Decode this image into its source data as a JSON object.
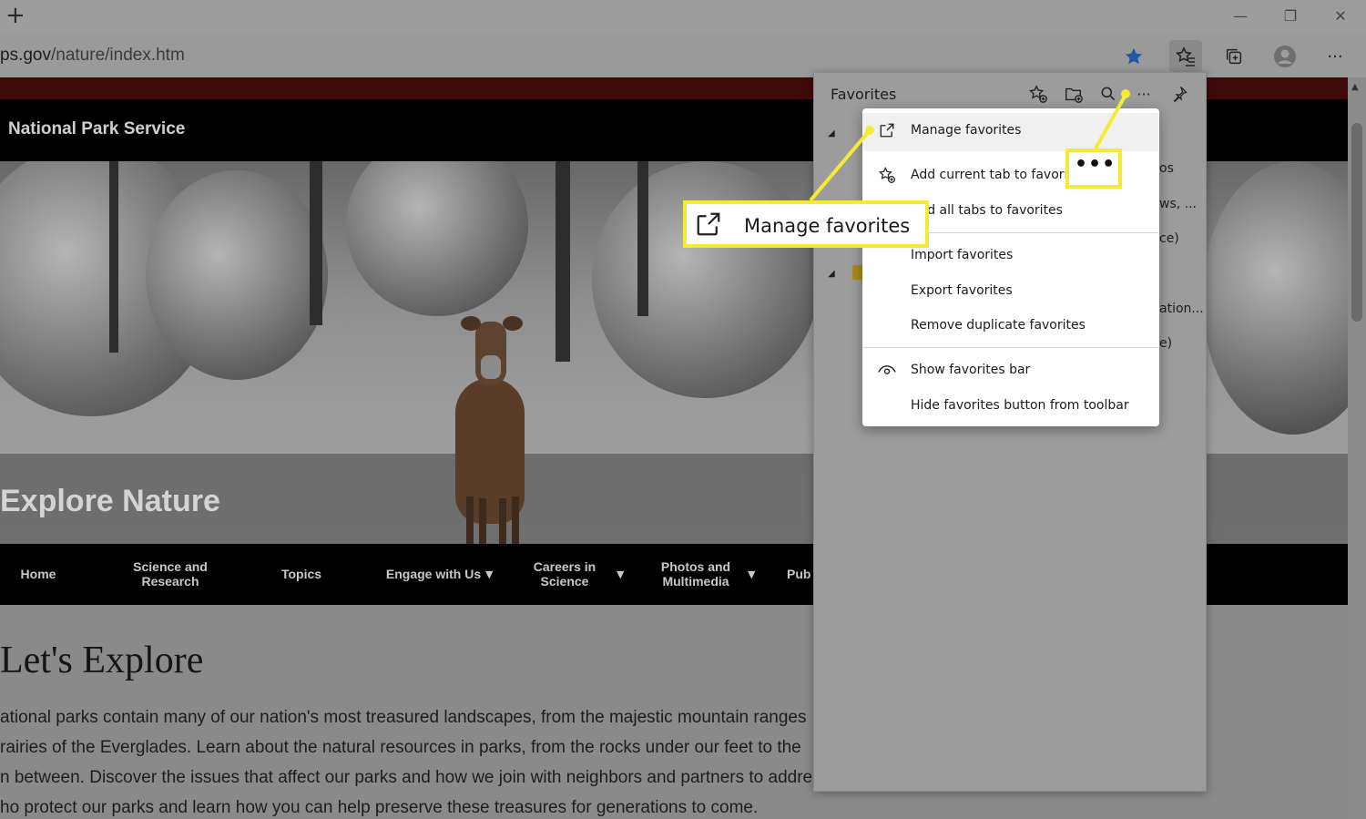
{
  "browser": {
    "url_domain": "ps.gov",
    "url_path": "/nature/index.htm",
    "new_tab_label": "+",
    "more_label": "···"
  },
  "site": {
    "org_title": "National Park Service",
    "hero_title": "Explore Nature",
    "nav": [
      {
        "label": "Home"
      },
      {
        "label": "Science and Research"
      },
      {
        "label": "Topics"
      },
      {
        "label": "Engage with Us"
      },
      {
        "label": "Careers in Science"
      },
      {
        "label": "Photos and Multimedia"
      },
      {
        "label": "Pub"
      }
    ],
    "heading": "Let's Explore",
    "paragraph_lines": [
      "ational parks contain many of our nation's most treasured landscapes, from the majestic mountain ranges",
      "rairies of the Everglades. Learn about the natural resources in parks, from the rocks under our feet to the",
      "n between. Discover the issues that affect our parks and how we join with neighbors and partners to addre",
      "ho protect our parks and learn how you can help preserve these treasures for generations to come."
    ]
  },
  "favorites_panel": {
    "title": "Favorites",
    "partial_texts": [
      "os",
      "ws, ...",
      "ce)",
      "ation...",
      "e)"
    ]
  },
  "context_menu": {
    "items": [
      {
        "label": "Manage favorites",
        "icon": "external-link-icon"
      },
      {
        "label": "Add current tab to favorites",
        "icon": "star-add-icon"
      },
      {
        "label": "Add all tabs to favorites",
        "icon": ""
      },
      {
        "label": "Import favorites",
        "icon": ""
      },
      {
        "label": "Export favorites",
        "icon": ""
      },
      {
        "label": "Remove duplicate favorites",
        "icon": ""
      },
      {
        "label": "Show favorites bar",
        "icon": "eye-icon"
      },
      {
        "label": "Hide favorites button from toolbar",
        "icon": ""
      }
    ]
  },
  "callouts": {
    "manage_label": "Manage favorites",
    "dots_label": "•••"
  },
  "colors": {
    "callout_yellow": "#f5ea35",
    "star_blue": "#1a5aa8"
  }
}
